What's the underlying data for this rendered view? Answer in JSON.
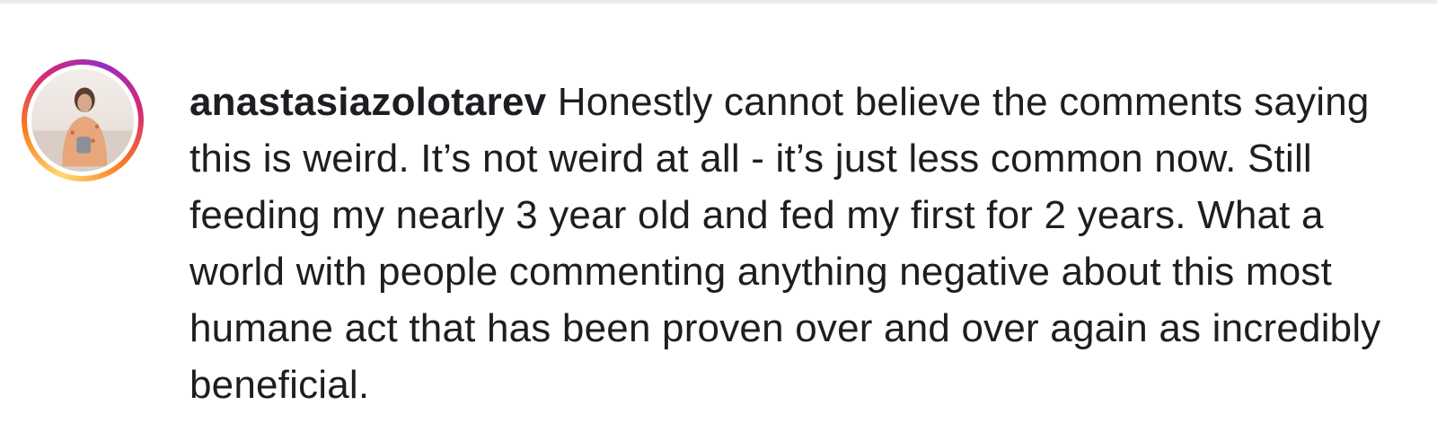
{
  "comment": {
    "username": "anastasiazolotarev",
    "text": "Honestly cannot believe the comments saying this is weird. It’s not weird at all - it’s just less common now. Still feeding my nearly 3 year old and fed my first for 2 years. What a world with people commenting anything negative about this most humane act that has been proven over and over again as incredibly beneficial."
  },
  "colors": {
    "text": "#1c1e21",
    "divider": "#ececec",
    "story_ring": [
      "#feda75",
      "#fa7e1e",
      "#d62976",
      "#962fbf"
    ]
  },
  "icons": {
    "avatar": "profile-photo"
  }
}
